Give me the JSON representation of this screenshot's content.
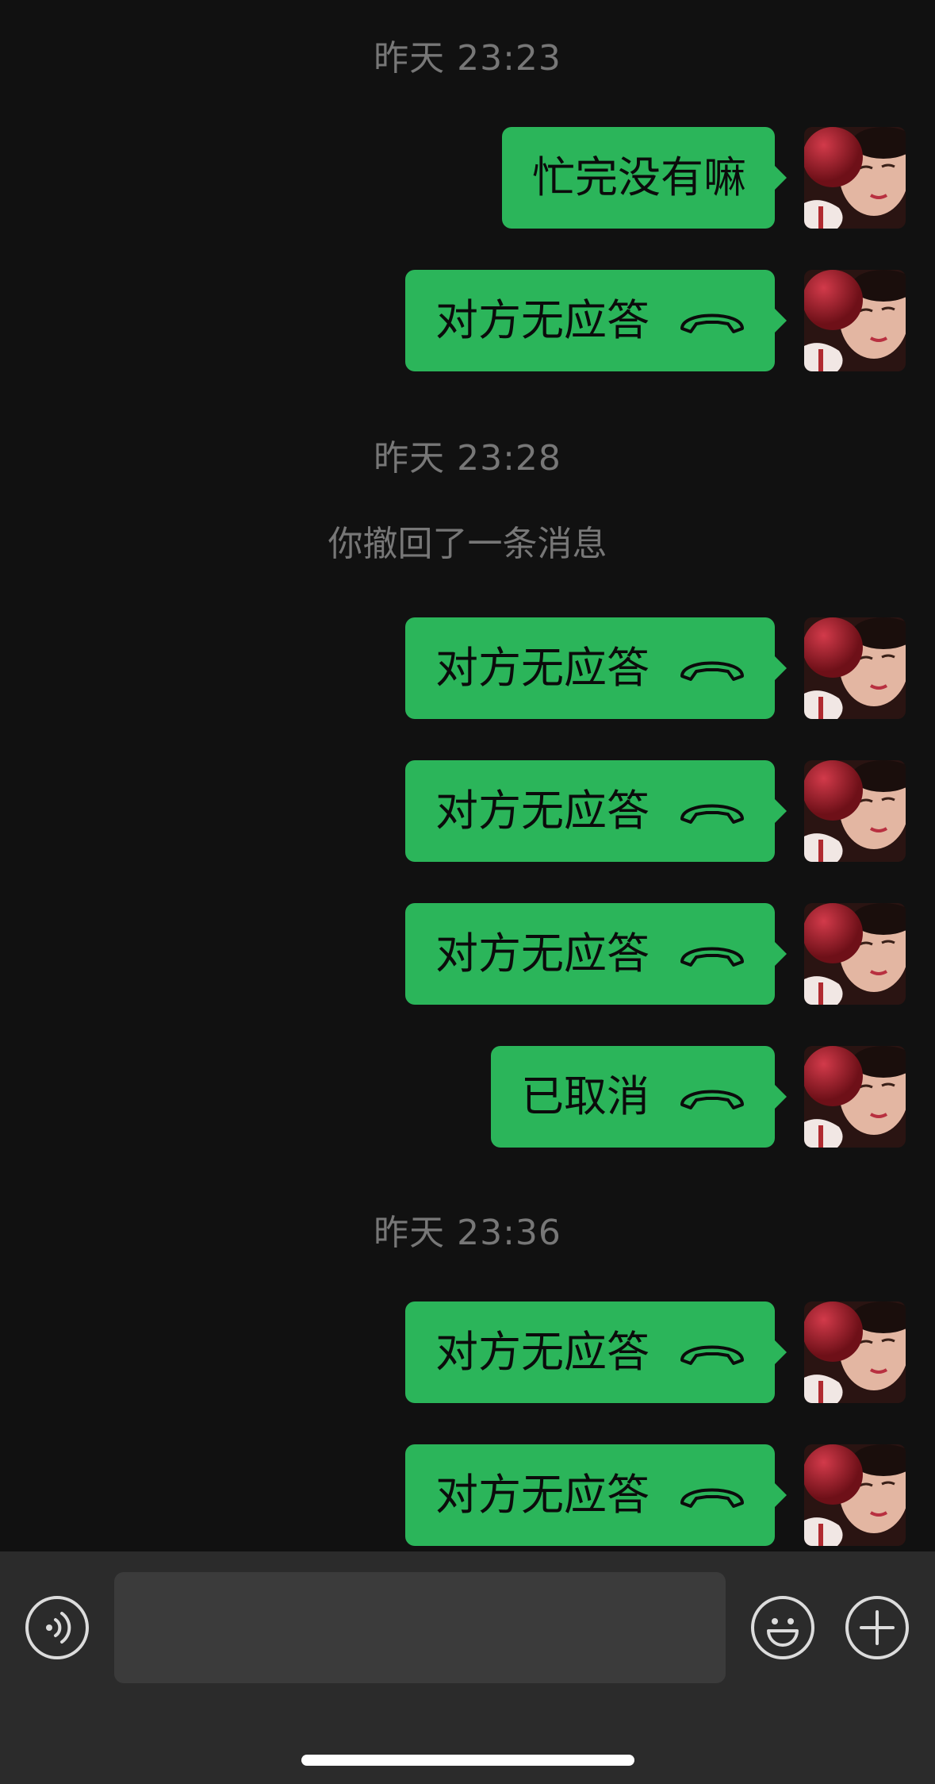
{
  "messages": [
    {
      "type": "time",
      "text": "昨天 23:23"
    },
    {
      "type": "text",
      "text": "忙完没有嘛"
    },
    {
      "type": "call",
      "text": "对方无应答",
      "icon": "phone-hangup-icon"
    },
    {
      "type": "time",
      "text": "昨天 23:28"
    },
    {
      "type": "system",
      "text": "你撤回了一条消息"
    },
    {
      "type": "call",
      "text": "对方无应答",
      "icon": "phone-hangup-icon"
    },
    {
      "type": "call",
      "text": "对方无应答",
      "icon": "phone-hangup-icon"
    },
    {
      "type": "call",
      "text": "对方无应答",
      "icon": "phone-hangup-icon"
    },
    {
      "type": "call",
      "text": "已取消",
      "icon": "phone-hangup-icon"
    },
    {
      "type": "time",
      "text": "昨天 23:36"
    },
    {
      "type": "call",
      "text": "对方无应答",
      "icon": "phone-hangup-icon"
    },
    {
      "type": "call",
      "text": "对方无应答",
      "icon": "phone-hangup-icon"
    }
  ],
  "input_bar": {
    "voice_icon": "voice-icon",
    "input_value": "",
    "emoji_icon": "emoji-icon",
    "plus_icon": "plus-icon"
  },
  "colors": {
    "background": "#111111",
    "bubble": "#2bb55a",
    "timestamp": "#777777",
    "input_bar": "#2b2b2b"
  }
}
